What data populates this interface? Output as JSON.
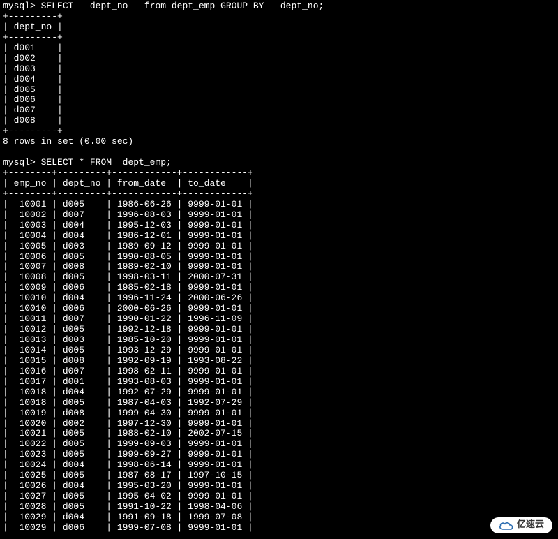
{
  "terminal": {
    "prompt": "mysql>",
    "query1": "SELECT   dept_no   from dept_emp GROUP BY   dept_no;",
    "query2": "SELECT * FROM  dept_emp;",
    "sep1": "+---------+",
    "hdr1_col": "| dept_no |",
    "dept_rows": [
      "| d001    |",
      "| d002    |",
      "| d003    |",
      "| d004    |",
      "| d005    |",
      "| d006    |",
      "| d007    |",
      "| d008    |"
    ],
    "result1_status": "8 rows in set (0.00 sec)",
    "sep2": "+--------+---------+------------+------------+",
    "hdr2_col": "| emp_no | dept_no | from_date  | to_date    |",
    "emp_rows": [
      "|  10001 | d005    | 1986-06-26 | 9999-01-01 |",
      "|  10002 | d007    | 1996-08-03 | 9999-01-01 |",
      "|  10003 | d004    | 1995-12-03 | 9999-01-01 |",
      "|  10004 | d004    | 1986-12-01 | 9999-01-01 |",
      "|  10005 | d003    | 1989-09-12 | 9999-01-01 |",
      "|  10006 | d005    | 1990-08-05 | 9999-01-01 |",
      "|  10007 | d008    | 1989-02-10 | 9999-01-01 |",
      "|  10008 | d005    | 1998-03-11 | 2000-07-31 |",
      "|  10009 | d006    | 1985-02-18 | 9999-01-01 |",
      "|  10010 | d004    | 1996-11-24 | 2000-06-26 |",
      "|  10010 | d006    | 2000-06-26 | 9999-01-01 |",
      "|  10011 | d007    | 1990-01-22 | 1996-11-09 |",
      "|  10012 | d005    | 1992-12-18 | 9999-01-01 |",
      "|  10013 | d003    | 1985-10-20 | 9999-01-01 |",
      "|  10014 | d005    | 1993-12-29 | 9999-01-01 |",
      "|  10015 | d008    | 1992-09-19 | 1993-08-22 |",
      "|  10016 | d007    | 1998-02-11 | 9999-01-01 |",
      "|  10017 | d001    | 1993-08-03 | 9999-01-01 |",
      "|  10018 | d004    | 1992-07-29 | 9999-01-01 |",
      "|  10018 | d005    | 1987-04-03 | 1992-07-29 |",
      "|  10019 | d008    | 1999-04-30 | 9999-01-01 |",
      "|  10020 | d002    | 1997-12-30 | 9999-01-01 |",
      "|  10021 | d005    | 1988-02-10 | 2002-07-15 |",
      "|  10022 | d005    | 1999-09-03 | 9999-01-01 |",
      "|  10023 | d005    | 1999-09-27 | 9999-01-01 |",
      "|  10024 | d004    | 1998-06-14 | 9999-01-01 |",
      "|  10025 | d005    | 1987-08-17 | 1997-10-15 |",
      "|  10026 | d004    | 1995-03-20 | 9999-01-01 |",
      "|  10027 | d005    | 1995-04-02 | 9999-01-01 |",
      "|  10028 | d005    | 1991-10-22 | 1998-04-06 |",
      "|  10029 | d004    | 1991-09-18 | 1999-07-08 |",
      "|  10029 | d006    | 1999-07-08 | 9999-01-01 |"
    ]
  },
  "watermark": {
    "label": "亿速云"
  }
}
